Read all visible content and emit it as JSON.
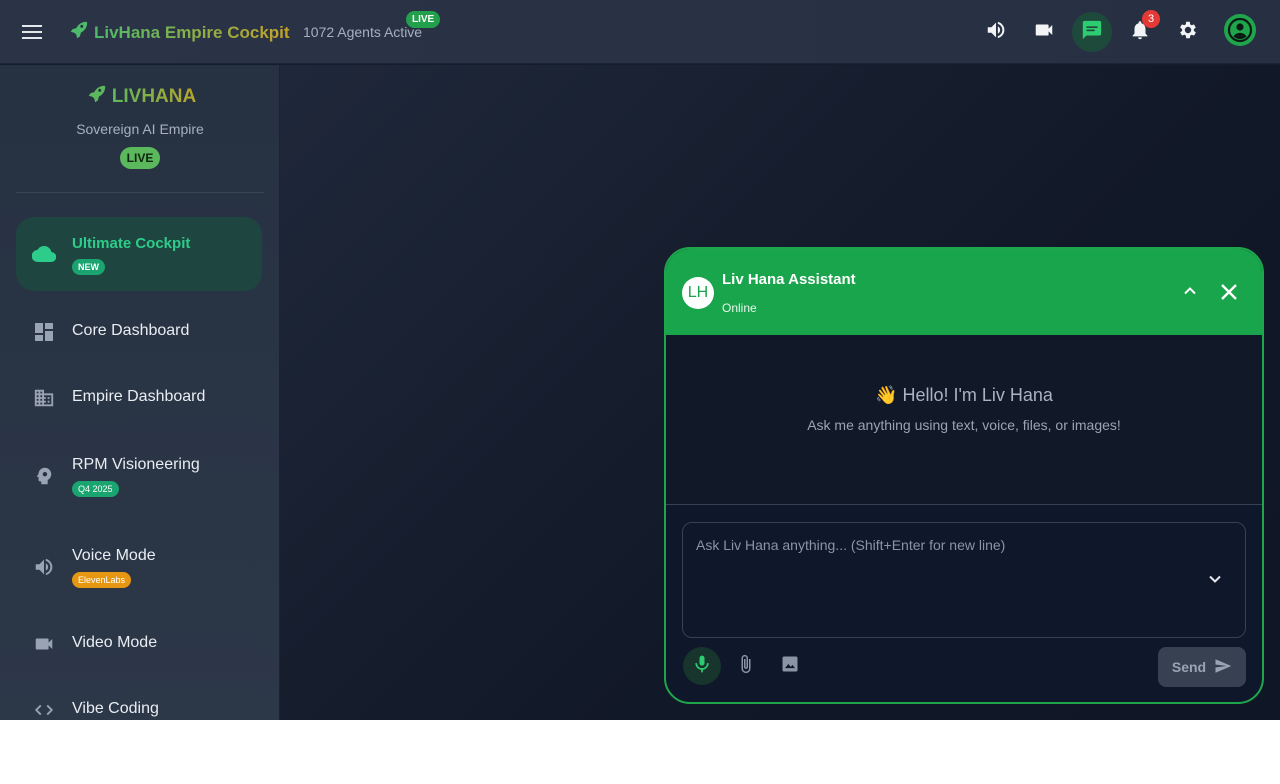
{
  "topbar": {
    "title": "LivHana Empire Cockpit",
    "agents_text": "1072 Agents Active",
    "live_label": "LIVE",
    "notifications_count": "3",
    "icons": [
      "menu-icon",
      "rocket-icon",
      "volume-icon",
      "video-camera-icon",
      "chat-icon",
      "bell-icon",
      "gear-icon",
      "account-icon"
    ]
  },
  "sidebar": {
    "brand": "LIVHANA",
    "subtitle": "Sovereign AI Empire",
    "live_label": "LIVE",
    "items": [
      {
        "label": "Ultimate Cockpit",
        "tag": "NEW",
        "icon": "cloud-icon",
        "active": true
      },
      {
        "label": "Core Dashboard",
        "tag": "",
        "icon": "dashboard-icon"
      },
      {
        "label": "Empire Dashboard",
        "tag": "",
        "icon": "building-icon"
      },
      {
        "label": "RPM Visioneering",
        "tag": "Q4 2025",
        "icon": "psychology-icon"
      },
      {
        "label": "Voice Mode",
        "tag": "ElevenLabs",
        "icon": "volume-icon"
      },
      {
        "label": "Video Mode",
        "tag": "",
        "icon": "video-camera-icon"
      },
      {
        "label": "Vibe Coding",
        "tag": "",
        "icon": "code-icon"
      }
    ]
  },
  "chat": {
    "avatar_initials": "LH",
    "title": "Liv Hana Assistant",
    "status": "Online",
    "greeting": "👋 Hello! I'm Liv Hana",
    "greeting_sub": "Ask me anything using text, voice, files, or images!",
    "input_placeholder": "Ask Liv Hana anything... (Shift+Enter for new line)",
    "input_value": "",
    "send_label": "Send"
  },
  "colors": {
    "accent_green": "#19a54b",
    "active_nav_text": "#2ecc8a",
    "badge_red": "#e53935",
    "tag_orange": "#e69712"
  }
}
